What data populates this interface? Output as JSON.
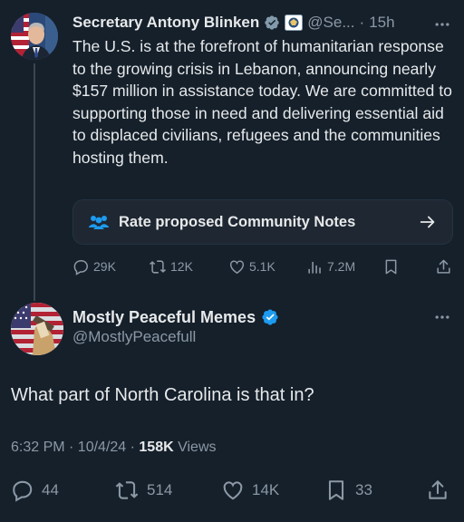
{
  "parent_tweet": {
    "author_name": "Secretary Antony Blinken",
    "handle": "@Se...",
    "separator": "·",
    "time": "15h",
    "text": "The U.S. is at the forefront of humanitarian response to the growing crisis in Lebanon, announcing nearly $157 million in assistance today. We are committed to supporting those in need and delivering essential aid to displaced civilians, refugees and the communities hosting them.",
    "community_notes_label": "Rate proposed Community Notes",
    "replies": "29K",
    "reposts": "12K",
    "likes": "5.1K",
    "views": "7.2M"
  },
  "reply": {
    "author_name": "Mostly Peaceful Memes",
    "handle": "@MostlyPeacefull",
    "text": "What part of North Carolina is that in?",
    "time": "6:32 PM · 10/4/24 · ",
    "views_count": "158K",
    "views_label": " Views",
    "replies": "44",
    "reposts": "514",
    "likes": "14K",
    "bookmarks": "33"
  },
  "colors": {
    "background": "#15202b",
    "text_primary": "#e7e9ea",
    "text_secondary": "#8b98a5",
    "verified_blue": "#1d9bf0",
    "government_gray": "#829aab"
  },
  "icons": [
    "verified-badge-icon",
    "government-flag-icon",
    "more-icon",
    "community-notes-icon",
    "arrow-right-icon",
    "reply-icon",
    "repost-icon",
    "like-icon",
    "views-icon",
    "bookmark-icon",
    "share-icon"
  ]
}
